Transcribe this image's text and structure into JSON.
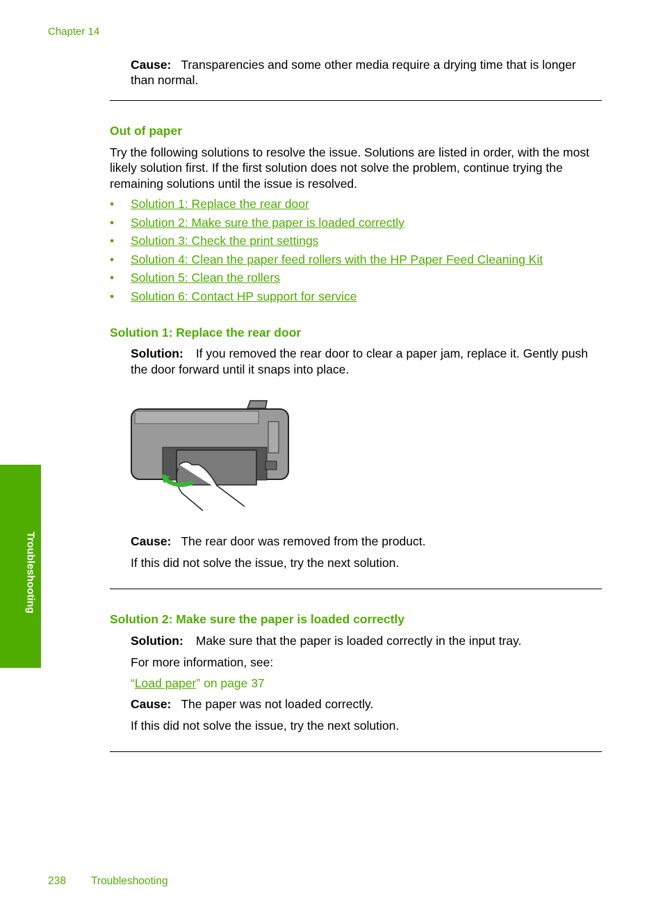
{
  "header": {
    "chapter": "Chapter 14"
  },
  "intro_cause": {
    "label": "Cause:",
    "text": "Transparencies and some other media require a drying time that is longer",
    "text2": "than normal."
  },
  "section": {
    "title": "Out of paper",
    "intro": [
      "Try the following solutions to resolve the issue. Solutions are listed in order, with the most",
      "likely solution first. If the first solution does not solve the problem, continue trying the",
      "remaining solutions until the issue is resolved."
    ],
    "links": [
      "Solution 1: Replace the rear door",
      "Solution 2: Make sure the paper is loaded correctly",
      "Solution 3: Check the print settings",
      "Solution 4: Clean the paper feed rollers with the HP Paper Feed Cleaning Kit",
      "Solution 5: Clean the rollers",
      "Solution 6: Contact HP support for service"
    ]
  },
  "solution1": {
    "title": "Solution 1: Replace the rear door",
    "solution_label": "Solution:",
    "solution_text": "If you removed the rear door to clear a paper jam, replace it. Gently push",
    "solution_text2": "the door forward until it snaps into place.",
    "cause_label": "Cause:",
    "cause_text": "The rear door was removed from the product.",
    "next": "If this did not solve the issue, try the next solution."
  },
  "solution2": {
    "title": "Solution 2: Make sure the paper is loaded correctly",
    "solution_label": "Solution:",
    "solution_text": "Make sure that the paper is loaded correctly in the input tray.",
    "more_info": "For more information, see:",
    "ref_link": "Load paper",
    "ref_open": "“",
    "ref_rest": "” on page 37",
    "cause_label": "Cause:",
    "cause_text": "The paper was not loaded correctly.",
    "next": "If this did not solve the issue, try the next solution."
  },
  "footer": {
    "page_number": "238",
    "section": "Troubleshooting"
  },
  "side_tab": {
    "label": "Troubleshooting"
  },
  "colors": {
    "accent": "#4fad00"
  },
  "bullet": "•"
}
